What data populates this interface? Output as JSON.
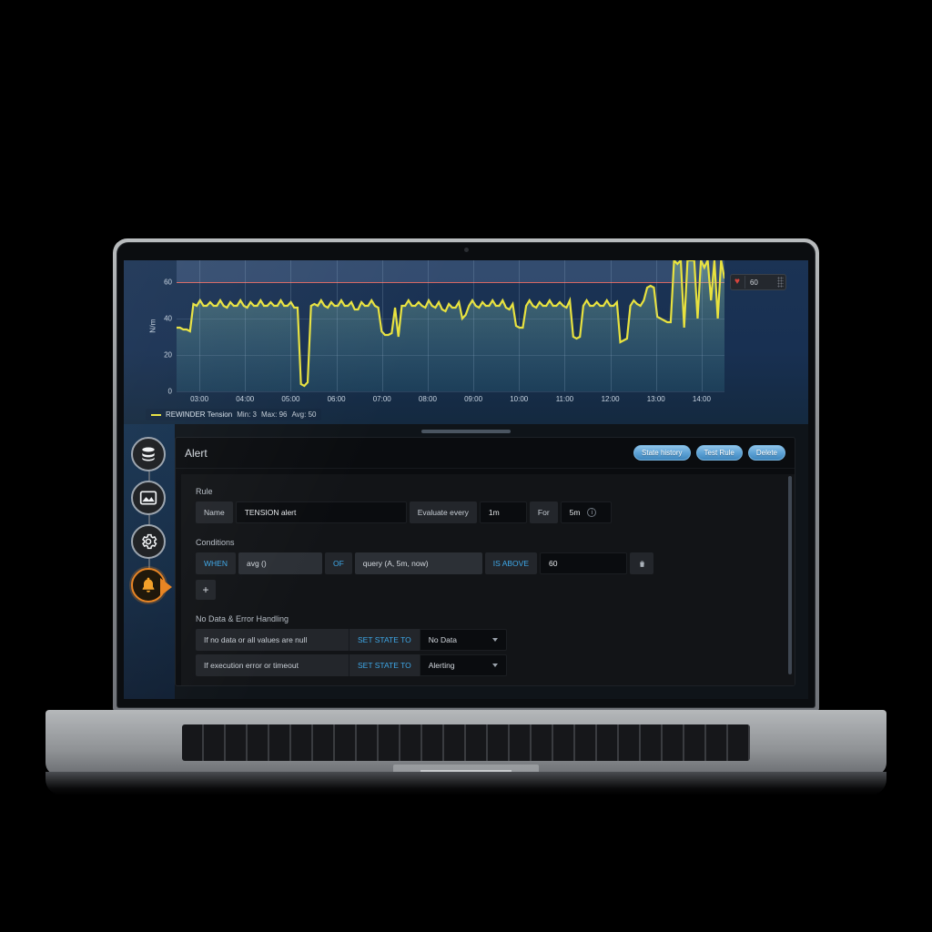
{
  "graph": {
    "y_axis_title": "N/m",
    "y_ticks": [
      "0",
      "20",
      "40",
      "60"
    ],
    "x_ticks": [
      "03:00",
      "04:00",
      "05:00",
      "06:00",
      "07:00",
      "08:00",
      "09:00",
      "10:00",
      "11:00",
      "12:00",
      "13:00",
      "14:00"
    ],
    "threshold_value": "60",
    "threshold_icon": "heart-icon",
    "legend": {
      "series": "REWINDER Tension",
      "min": "Min: 3",
      "max": "Max: 96",
      "avg": "Avg: 50"
    }
  },
  "chart_data": {
    "type": "line",
    "title": "REWINDER Tension",
    "xlabel": "",
    "ylabel": "N/m",
    "ylim": [
      0,
      72
    ],
    "yticks": [
      0,
      20,
      40,
      60
    ],
    "x": [
      "03:00",
      "04:00",
      "05:00",
      "06:00",
      "07:00",
      "08:00",
      "09:00",
      "10:00",
      "11:00",
      "12:00",
      "13:00",
      "14:00"
    ],
    "threshold": 60,
    "threshold_color": "#e0584d",
    "line_color": "#e8e23f",
    "grid": true,
    "legend_position": "bottom-left",
    "stats": {
      "min": 3,
      "max": 96,
      "avg": 50
    },
    "series": [
      {
        "name": "REWINDER Tension",
        "values": [
          35,
          35,
          34,
          34,
          33,
          48,
          47,
          50,
          47,
          47,
          49,
          47,
          47,
          50,
          47,
          46,
          49,
          47,
          47,
          50,
          47,
          46,
          49,
          47,
          47,
          50,
          47,
          47,
          49,
          47,
          47,
          50,
          47,
          47,
          49,
          46,
          46,
          4,
          3,
          5,
          47,
          48,
          47,
          50,
          47,
          46,
          49,
          47,
          47,
          50,
          47,
          47,
          49,
          45,
          45,
          49,
          47,
          47,
          50,
          47,
          46,
          33,
          31,
          31,
          32,
          46,
          30,
          47,
          47,
          50,
          47,
          47,
          49,
          47,
          46,
          50,
          47,
          46,
          49,
          45,
          44,
          48,
          46,
          46,
          49,
          40,
          42,
          47,
          50,
          47,
          46,
          49,
          47,
          47,
          50,
          47,
          47,
          50,
          46,
          45,
          48,
          36,
          35,
          35,
          47,
          50,
          47,
          46,
          49,
          47,
          47,
          50,
          47,
          47,
          49,
          47,
          46,
          50,
          30,
          29,
          30,
          47,
          50,
          47,
          47,
          49,
          47,
          47,
          50,
          47,
          47,
          49,
          27,
          28,
          29,
          47,
          50,
          48,
          47,
          50,
          57,
          58,
          57,
          41,
          40,
          39,
          38,
          38,
          96,
          70,
          96,
          35,
          96,
          92,
          96,
          40,
          96,
          68,
          96,
          50,
          96,
          40,
          96,
          62
        ]
      }
    ]
  },
  "sidebar": {
    "items": [
      {
        "name": "datasources",
        "icon": "database-icon",
        "active": false
      },
      {
        "name": "dashboards",
        "icon": "graph-panel-icon",
        "active": false
      },
      {
        "name": "configuration",
        "icon": "gear-icon",
        "active": false
      },
      {
        "name": "alerting",
        "icon": "bell-icon",
        "active": true
      }
    ]
  },
  "alert_panel": {
    "title": "Alert",
    "buttons": [
      {
        "label": "State history",
        "name": "state-history-button"
      },
      {
        "label": "Test Rule",
        "name": "test-rule-button"
      },
      {
        "label": "Delete",
        "name": "delete-button"
      }
    ],
    "rule": {
      "section_label": "Rule",
      "name_label": "Name",
      "name_value": "TENSION alert",
      "evaluate_label": "Evaluate every",
      "evaluate_value": "1m",
      "for_label": "For",
      "for_value": "5m",
      "info_icon": "info-icon"
    },
    "conditions": {
      "section_label": "Conditions",
      "rows": [
        {
          "when": "WHEN",
          "reducer": "avg ()",
          "of": "OF",
          "query": "query (A, 5m, now)",
          "evaluator": "IS ABOVE",
          "value": "60",
          "delete_icon": "trash-icon"
        }
      ],
      "add_label": "+"
    },
    "no_data": {
      "section_label": "No Data & Error Handling",
      "rows": [
        {
          "condition": "If no data or all values are null",
          "action": "SET STATE TO",
          "state": "No Data"
        },
        {
          "condition": "If execution error or timeout",
          "action": "SET STATE TO",
          "state": "Alerting"
        }
      ]
    }
  }
}
